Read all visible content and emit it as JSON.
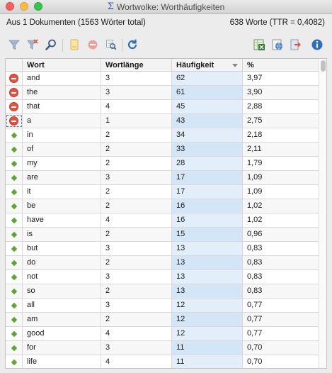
{
  "window": {
    "title": "Wortwolke: Worthäufigkeiten"
  },
  "info": {
    "left": "Aus 1 Dokumenten (1563 Wörter total)",
    "right": "638 Worte (TTR = 0,4082)"
  },
  "toolbar": {
    "icons": [
      "filter-icon",
      "filter-clear-icon",
      "search-icon",
      "document-icon",
      "remove-icon",
      "inspect-icon",
      "refresh-icon",
      "export-excel-icon",
      "export-html-icon",
      "export-file-icon",
      "info-icon"
    ]
  },
  "table": {
    "headers": {
      "wort": "Wort",
      "laenge": "Wortlänge",
      "freq": "Häufigkeit",
      "pct": "%"
    },
    "rows": [
      {
        "icon": "stop",
        "wort": "and",
        "laenge": "3",
        "freq": "62",
        "pct": "3,97"
      },
      {
        "icon": "stop",
        "wort": "the",
        "laenge": "3",
        "freq": "61",
        "pct": "3,90"
      },
      {
        "icon": "stop",
        "wort": "that",
        "laenge": "4",
        "freq": "45",
        "pct": "2,88"
      },
      {
        "icon": "stop",
        "wort": "a",
        "laenge": "1",
        "freq": "43",
        "pct": "2,75"
      },
      {
        "icon": "go",
        "wort": "in",
        "laenge": "2",
        "freq": "34",
        "pct": "2,18"
      },
      {
        "icon": "go",
        "wort": "of",
        "laenge": "2",
        "freq": "33",
        "pct": "2,11"
      },
      {
        "icon": "go",
        "wort": "my",
        "laenge": "2",
        "freq": "28",
        "pct": "1,79"
      },
      {
        "icon": "go",
        "wort": "are",
        "laenge": "3",
        "freq": "17",
        "pct": "1,09"
      },
      {
        "icon": "go",
        "wort": "it",
        "laenge": "2",
        "freq": "17",
        "pct": "1,09"
      },
      {
        "icon": "go",
        "wort": "be",
        "laenge": "2",
        "freq": "16",
        "pct": "1,02"
      },
      {
        "icon": "go",
        "wort": "have",
        "laenge": "4",
        "freq": "16",
        "pct": "1,02"
      },
      {
        "icon": "go",
        "wort": "is",
        "laenge": "2",
        "freq": "15",
        "pct": "0,96"
      },
      {
        "icon": "go",
        "wort": "but",
        "laenge": "3",
        "freq": "13",
        "pct": "0,83"
      },
      {
        "icon": "go",
        "wort": "do",
        "laenge": "2",
        "freq": "13",
        "pct": "0,83"
      },
      {
        "icon": "go",
        "wort": "not",
        "laenge": "3",
        "freq": "13",
        "pct": "0,83"
      },
      {
        "icon": "go",
        "wort": "so",
        "laenge": "2",
        "freq": "13",
        "pct": "0,83"
      },
      {
        "icon": "go",
        "wort": "all",
        "laenge": "3",
        "freq": "12",
        "pct": "0,77"
      },
      {
        "icon": "go",
        "wort": "am",
        "laenge": "2",
        "freq": "12",
        "pct": "0,77"
      },
      {
        "icon": "go",
        "wort": "good",
        "laenge": "4",
        "freq": "12",
        "pct": "0,77"
      },
      {
        "icon": "go",
        "wort": "for",
        "laenge": "3",
        "freq": "11",
        "pct": "0,70"
      },
      {
        "icon": "go",
        "wort": "life",
        "laenge": "4",
        "freq": "11",
        "pct": "0,70"
      }
    ]
  }
}
